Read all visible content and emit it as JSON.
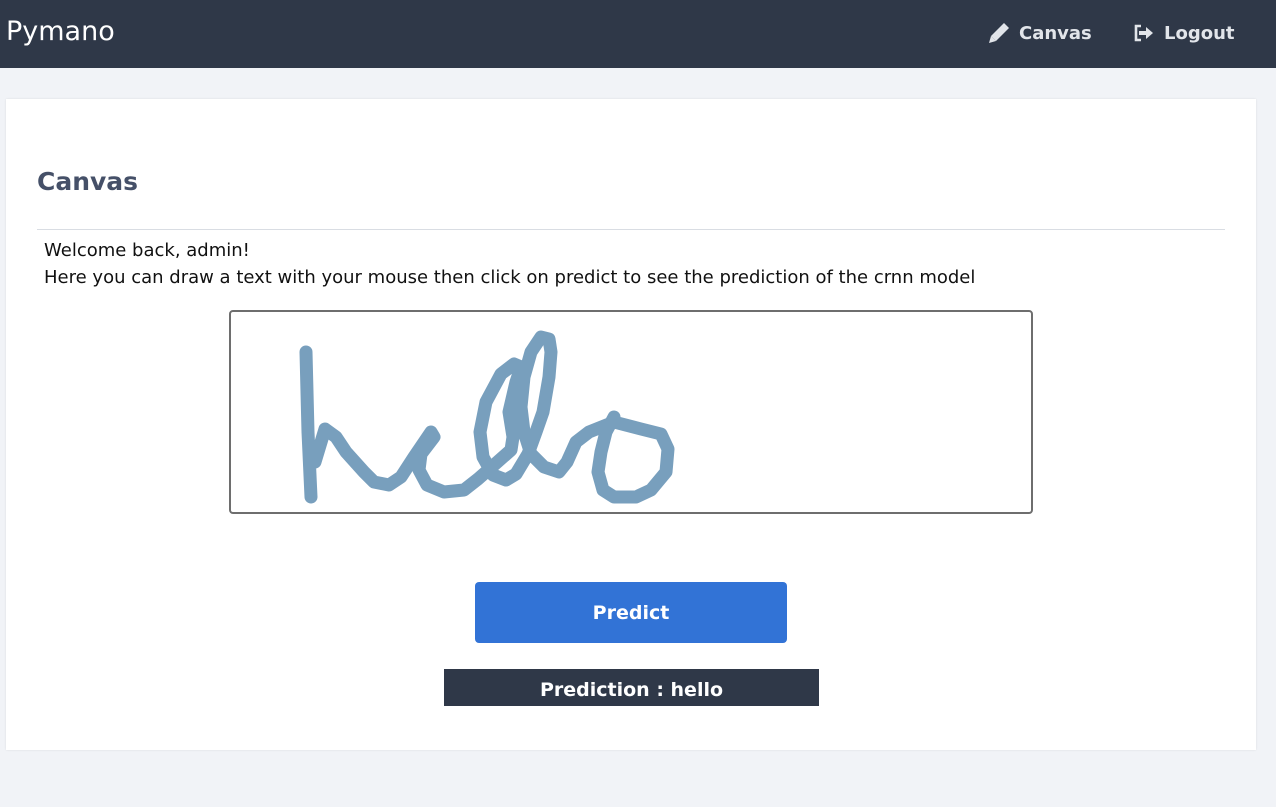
{
  "navbar": {
    "brand": "Pymano",
    "links": [
      {
        "label": "Canvas",
        "icon": "pencil-icon"
      },
      {
        "label": "Logout",
        "icon": "logout-icon"
      }
    ]
  },
  "main": {
    "title": "Canvas",
    "welcome": "Welcome back, admin!",
    "instructions": "Here you can draw a text with your mouse then click on predict to see the prediction of the crnn model",
    "predict_button": "Predict",
    "prediction_label": "Prediction : hello"
  },
  "colors": {
    "navbar_bg": "#2f3848",
    "page_bg": "#f1f3f7",
    "primary_button": "#3273d6",
    "stroke": "#789fbd",
    "title": "#455068"
  }
}
